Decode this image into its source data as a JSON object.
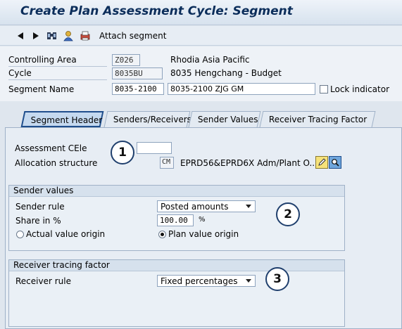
{
  "window": {
    "title": "Create Plan Assessment Cycle: Segment"
  },
  "toolbar": {
    "icons": [
      "back-arrow-icon",
      "forward-arrow-icon",
      "find-icon",
      "user-icon",
      "print-icon"
    ],
    "attach_label": "Attach segment"
  },
  "header": {
    "controlling_area": {
      "label": "Controlling Area",
      "value": "Z026",
      "description": "Rhodia Asia Pacific"
    },
    "cycle": {
      "label": "Cycle",
      "value": "8035BU",
      "description": "8035 Hengchang - Budget"
    },
    "segment_name": {
      "label": "Segment Name",
      "value": "8035-2100",
      "description": "8035-2100 ZJG GM"
    },
    "lock_indicator_label": "Lock indicator"
  },
  "tabs": [
    {
      "label": "Segment Header",
      "active": true
    },
    {
      "label": "Senders/Receivers",
      "active": false
    },
    {
      "label": "Sender Values",
      "active": false
    },
    {
      "label": "Receiver Tracing Factor",
      "active": false
    }
  ],
  "segment_header": {
    "assessment_cele_label": "Assessment CEle",
    "assessment_cele_value": "",
    "allocation_structure_label": "Allocation structure",
    "allocation_structure_value": "CM",
    "allocation_structure_desc": "EPRD56&EPRD6X Adm/Plant O..."
  },
  "sender_values": {
    "group_title": "Sender values",
    "sender_rule_label": "Sender rule",
    "sender_rule_value": "Posted amounts",
    "share_label": "Share in %",
    "share_value": "100.00",
    "share_unit": "%",
    "actual_origin_label": "Actual value origin",
    "plan_origin_label": "Plan value origin",
    "selected_origin": "plan"
  },
  "receiver_tracing": {
    "group_title": "Receiver tracing factor",
    "receiver_rule_label": "Receiver rule",
    "receiver_rule_value": "Fixed percentages"
  },
  "callouts": [
    "1",
    "2",
    "3"
  ]
}
